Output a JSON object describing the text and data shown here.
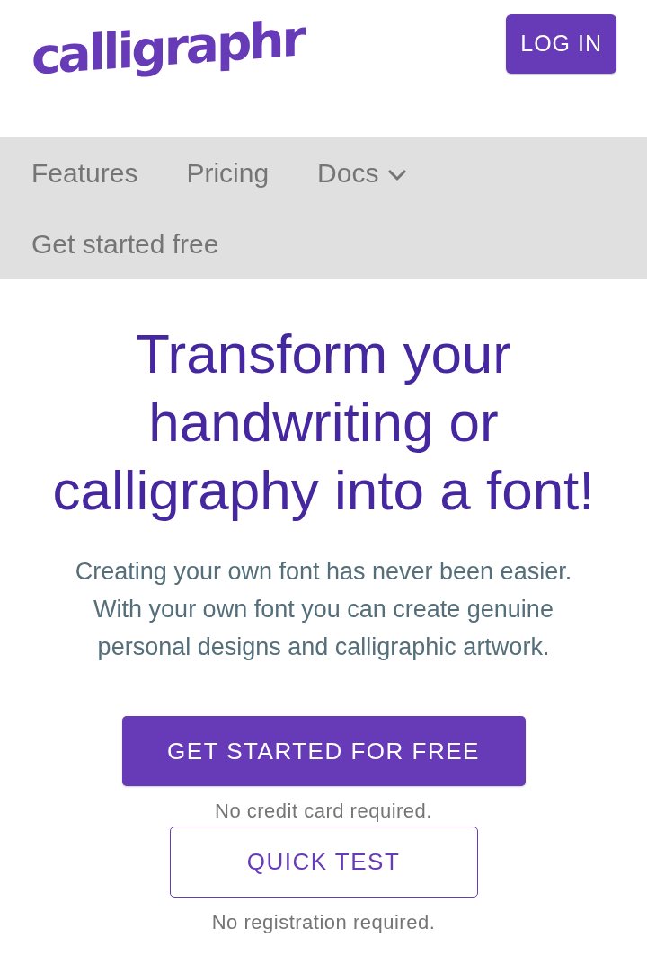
{
  "header": {
    "logo": "calligraphr",
    "login_button": "LOG IN"
  },
  "nav": {
    "items": [
      {
        "label": "Features",
        "kind": "link"
      },
      {
        "label": "Pricing",
        "kind": "link"
      },
      {
        "label": "Docs",
        "kind": "dropdown"
      },
      {
        "label": "Get started free",
        "kind": "link"
      }
    ]
  },
  "hero": {
    "title": "Transform your handwriting or calligraphy into a font!",
    "description": "Creating your own font has never been easier. With your own font you can create genuine personal designs and calligraphic artwork.",
    "primary_button": "GET STARTED FOR FREE",
    "primary_note": "No credit card required.",
    "secondary_button": "QUICK TEST",
    "secondary_note": "No registration required."
  }
}
